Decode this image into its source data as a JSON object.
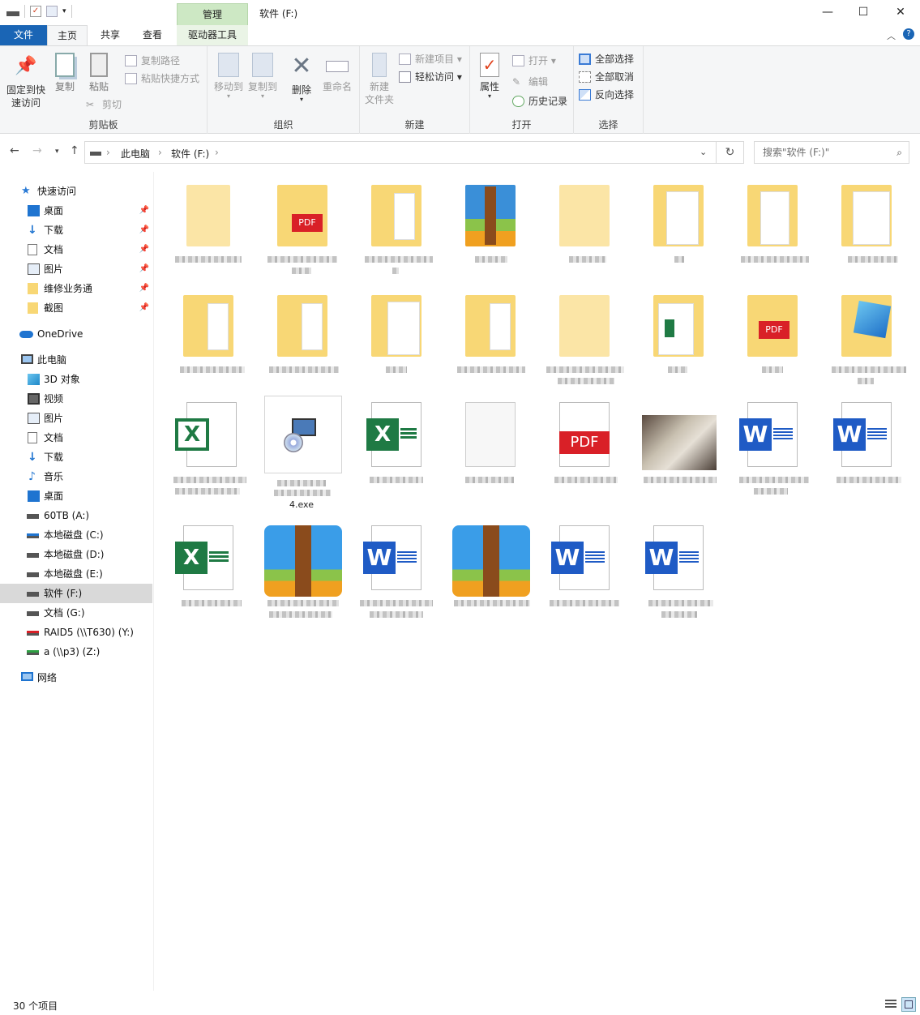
{
  "window": {
    "title": "软件 (F:)",
    "context_tab": "管理"
  },
  "ribbon_tabs": [
    "文件",
    "主页",
    "共享",
    "查看",
    "驱动器工具"
  ],
  "ribbon": {
    "clipboard": {
      "label": "剪贴板",
      "pin": "固定到快\n速访问",
      "pin_l1": "固定到快",
      "pin_l2": "速访问",
      "copy": "复制",
      "paste": "粘贴",
      "copy_path": "复制路径",
      "paste_shortcut": "粘贴快捷方式",
      "cut": "剪切"
    },
    "organize": {
      "label": "组织",
      "move_to": "移动到",
      "copy_to": "复制到",
      "delete": "删除",
      "rename": "重命名"
    },
    "new": {
      "label": "新建",
      "new_folder_l1": "新建",
      "new_folder_l2": "文件夹",
      "new_item": "新建项目",
      "easy_access": "轻松访问"
    },
    "open": {
      "label": "打开",
      "properties": "属性",
      "open": "打开",
      "edit": "编辑",
      "history": "历史记录"
    },
    "select": {
      "label": "选择",
      "select_all": "全部选择",
      "select_none": "全部取消",
      "invert": "反向选择"
    }
  },
  "address": {
    "crumbs": [
      "此电脑",
      "软件 (F:)"
    ],
    "search_placeholder": "搜索\"软件 (F:)\""
  },
  "nav": {
    "quick_access": "快速访问",
    "qa_items": [
      "桌面",
      "下载",
      "文档",
      "图片",
      "维修业务通",
      "截图"
    ],
    "onedrive": "OneDrive",
    "this_pc": "此电脑",
    "pc_items": [
      "3D 对象",
      "视频",
      "图片",
      "文档",
      "下载",
      "音乐",
      "桌面"
    ],
    "drives": [
      "60TB (A:)",
      "本地磁盘 (C:)",
      "本地磁盘 (D:)",
      "本地磁盘 (E:)",
      "软件 (F:)",
      "文档 (G:)",
      "RAID5 (\\\\T630) (Y:)",
      "a (\\\\p3) (Z:)"
    ],
    "network": "网络"
  },
  "files": {
    "visible_name": "4.exe"
  },
  "status": {
    "count": "30 个项目"
  },
  "colors": {
    "accent": "#1a65b5",
    "folder": "#f8d775",
    "excel": "#1f7a44",
    "word": "#1f5bc5",
    "pdf": "#d92027"
  }
}
